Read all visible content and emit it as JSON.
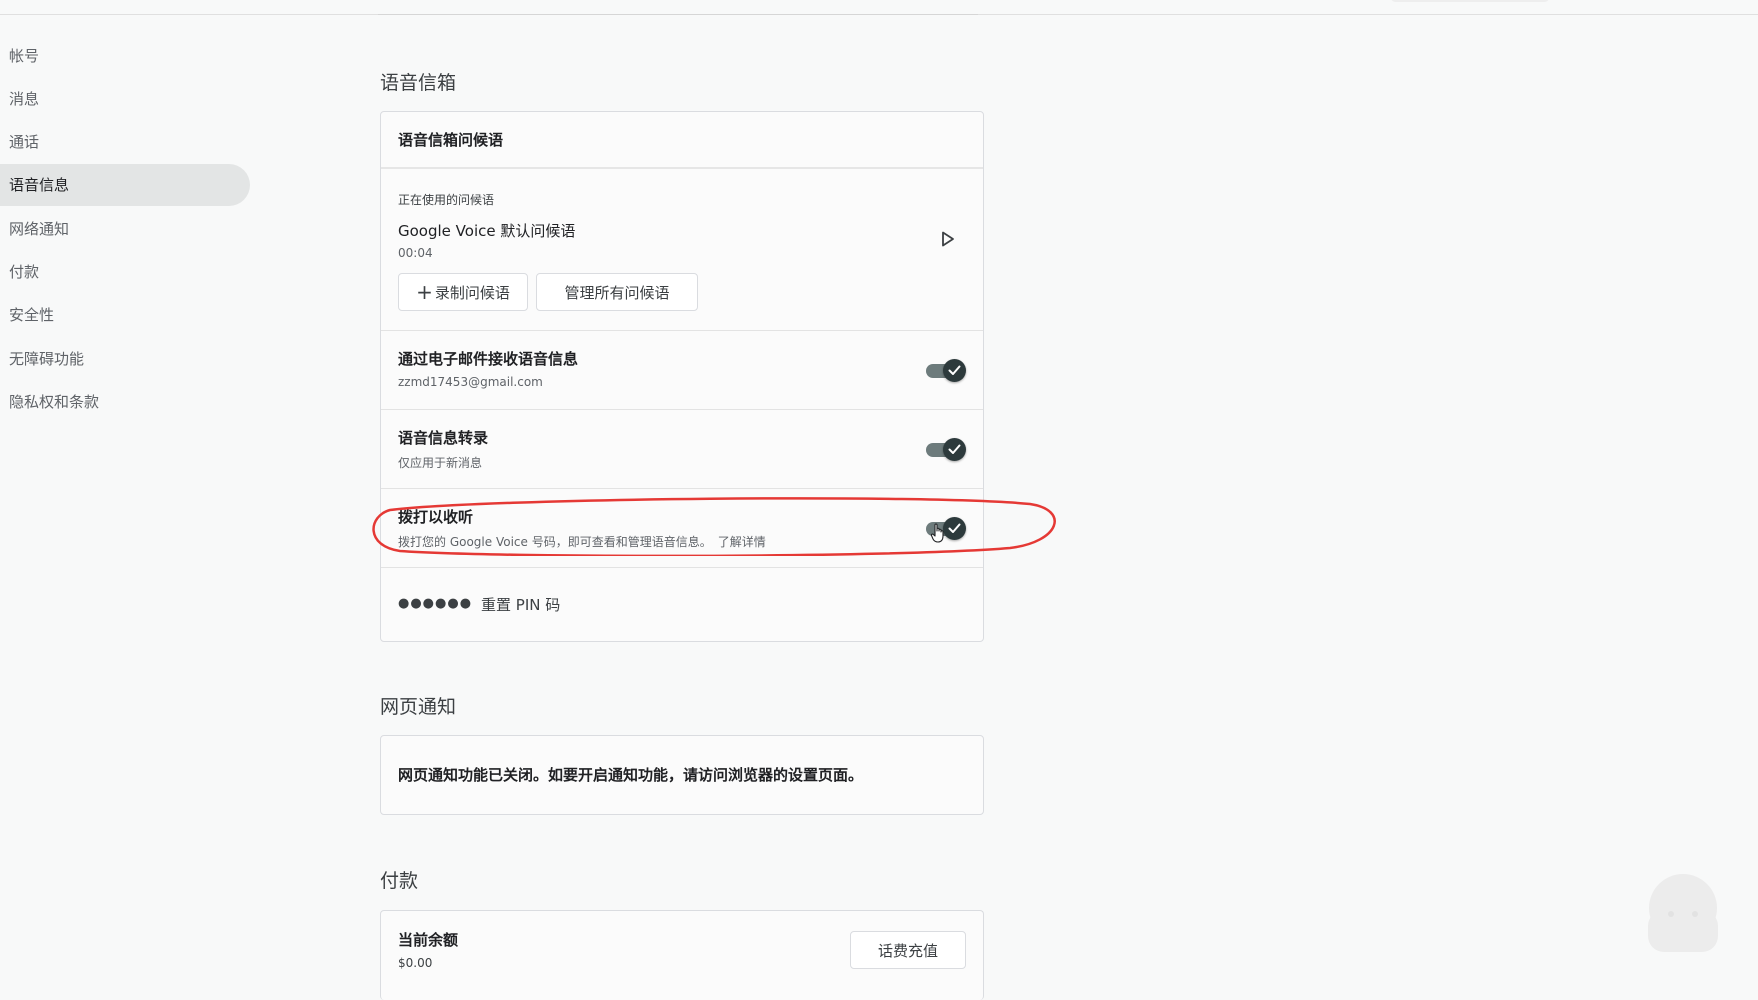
{
  "sidebar": {
    "items": [
      {
        "label": "帐号"
      },
      {
        "label": "消息"
      },
      {
        "label": "通话"
      },
      {
        "label": "语音信息",
        "active": true
      },
      {
        "label": "网络通知"
      },
      {
        "label": "付款"
      },
      {
        "label": "安全性"
      },
      {
        "label": "无障碍功能"
      },
      {
        "label": "隐私权和条款"
      }
    ]
  },
  "voicemail": {
    "section_title": "语音信箱",
    "greeting": {
      "header": "语音信箱问候语",
      "in_use_label": "正在使用的问候语",
      "name": "Google Voice 默认问候语",
      "duration": "00:04",
      "record_label": "录制问候语",
      "manage_label": "管理所有问候语"
    },
    "email_toggle": {
      "title": "通过电子邮件接收语音信息",
      "subtitle": "zzmd17453@gmail.com",
      "on": true
    },
    "transcribe_toggle": {
      "title": "语音信息转录",
      "subtitle": "仅应用于新消息",
      "on": true
    },
    "dial_in_toggle": {
      "title": "拨打以收听",
      "subtitle": "拨打您的 Google Voice 号码，即可查看和管理语音信息。",
      "link": "了解详情",
      "on": true
    },
    "pin": {
      "dots": "●●●●●●",
      "reset_label": "重置 PIN 码"
    }
  },
  "web_notifications": {
    "section_title": "网页通知",
    "message": "网页通知功能已关闭。如要开启通知功能，请访问浏览器的设置页面。"
  },
  "payments": {
    "section_title": "付款",
    "balance_label": "当前余额",
    "balance_value": "$0.00",
    "topup_label": "话费充值"
  },
  "colors": {
    "toggle_on": "#2d3a3c",
    "annotation": "#e53935",
    "sidebar_active_bg": "#e3e5e5"
  }
}
